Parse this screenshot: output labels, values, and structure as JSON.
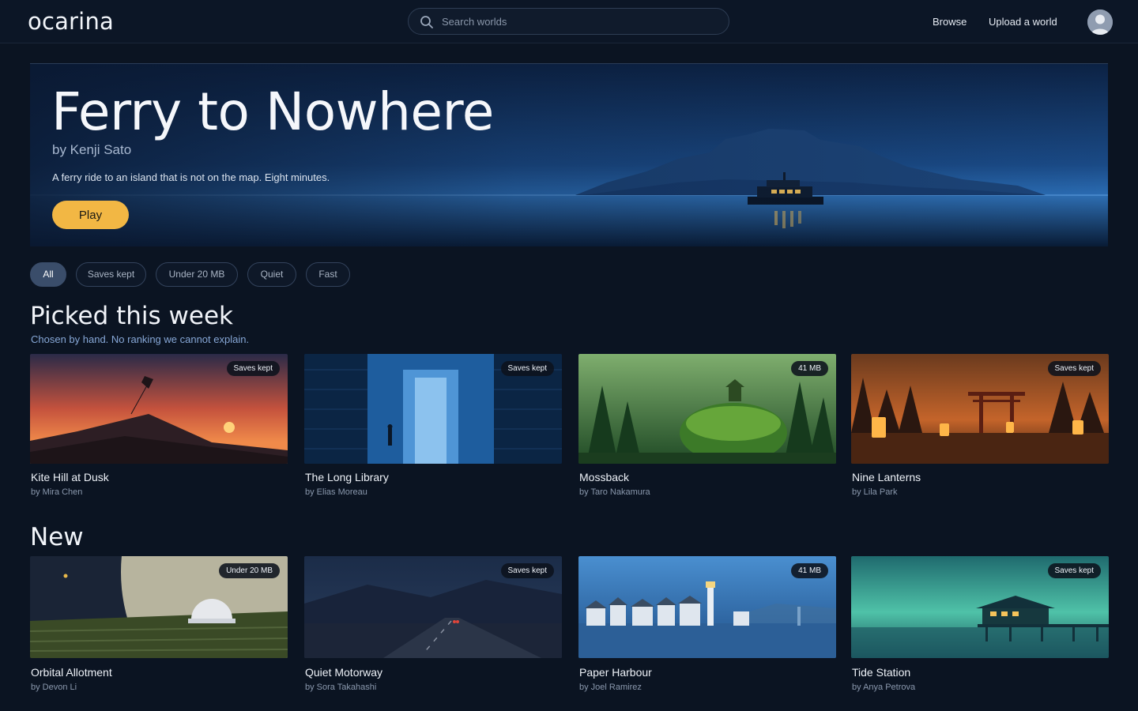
{
  "header": {
    "logo": "ocarina",
    "search_placeholder": "Search worlds",
    "nav": [
      "Browse",
      "Upload a world"
    ]
  },
  "hero": {
    "title": "Ferry to Nowhere",
    "author": "by Kenji Sato",
    "description": "A ferry ride to an island that is not on the map. Eight minutes.",
    "play_label": "Play"
  },
  "filters": [
    {
      "label": "All",
      "active": true
    },
    {
      "label": "Saves kept",
      "active": false
    },
    {
      "label": "Under 20 MB",
      "active": false
    },
    {
      "label": "Quiet",
      "active": false
    },
    {
      "label": "Fast",
      "active": false
    }
  ],
  "picked": {
    "title": "Picked this week",
    "subtitle": "Chosen by hand. No ranking we cannot explain.",
    "cards": [
      {
        "title": "Kite Hill at Dusk",
        "author": "by Mira Chen",
        "badge": "Saves kept"
      },
      {
        "title": "The Long Library",
        "author": "by Elias Moreau",
        "badge": "Saves kept"
      },
      {
        "title": "Mossback",
        "author": "by Taro Nakamura",
        "badge": "41 MB"
      },
      {
        "title": "Nine Lanterns",
        "author": "by Lila Park",
        "badge": "Saves kept"
      }
    ]
  },
  "new": {
    "title": "New",
    "cards": [
      {
        "title": "Orbital Allotment",
        "author": "by Devon Li",
        "badge": "Under 20 MB"
      },
      {
        "title": "Quiet Motorway",
        "author": "by Sora Takahashi",
        "badge": "Saves kept"
      },
      {
        "title": "Paper Harbour",
        "author": "by Joel Ramirez",
        "badge": "41 MB"
      },
      {
        "title": "Tide Station",
        "author": "by Anya Petrova",
        "badge": "Saves kept"
      }
    ]
  },
  "colors": {
    "accent": "#f2b744",
    "background": "#0b1422",
    "chip_active": "#3a4d6a"
  }
}
